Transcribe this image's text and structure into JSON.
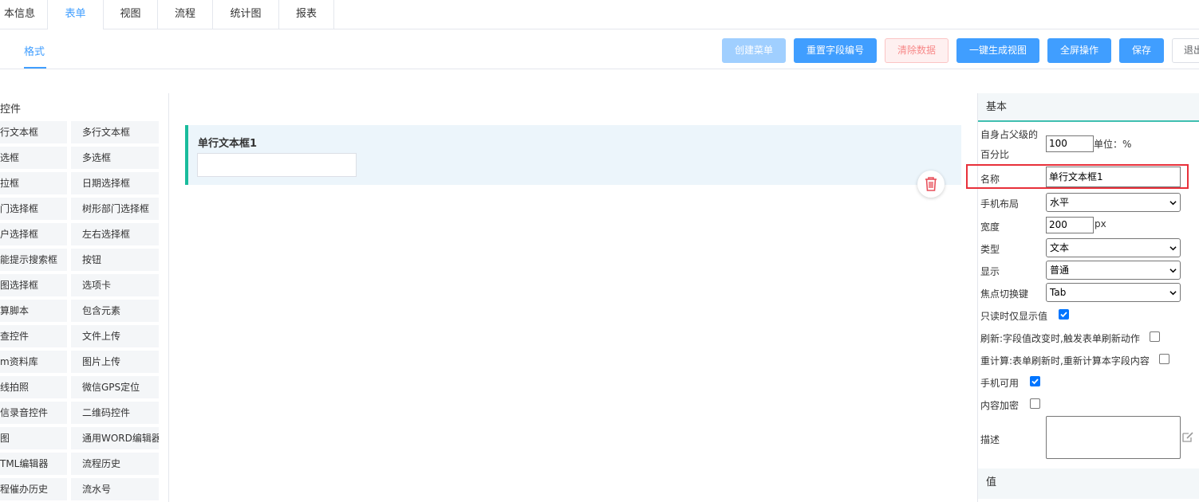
{
  "top_tabs": [
    {
      "label": "本信息"
    },
    {
      "label": "表单"
    },
    {
      "label": "视图"
    },
    {
      "label": "流程"
    },
    {
      "label": "统计图"
    },
    {
      "label": "报表"
    }
  ],
  "sub_tab": {
    "label": "格式"
  },
  "toolbar": {
    "create_menu": "创建菜单",
    "reset_field_no": "重置字段编号",
    "clear_data": "清除数据",
    "gen_view": "一键生成视图",
    "fullscreen": "全屏操作",
    "save": "保存",
    "exit": "退出"
  },
  "palette": {
    "title": "控件",
    "items": [
      [
        "行文本框",
        "多行文本框"
      ],
      [
        "选框",
        "多选框"
      ],
      [
        "拉框",
        "日期选择框"
      ],
      [
        "门选择框",
        "树形部门选择框"
      ],
      [
        "户选择框",
        "左右选择框"
      ],
      [
        "能提示搜索框",
        "按钮"
      ],
      [
        "图选择框",
        "选项卡"
      ],
      [
        "算脚本",
        "包含元素"
      ],
      [
        "查控件",
        "文件上传"
      ],
      [
        "m资料库",
        "图片上传"
      ],
      [
        "线拍照",
        "微信GPS定位"
      ],
      [
        "信录音控件",
        "二维码控件"
      ],
      [
        "图",
        "通用WORD编辑器"
      ],
      [
        "TML编辑器",
        "流程历史"
      ],
      [
        "程催办历史",
        "流水号"
      ]
    ]
  },
  "canvas": {
    "field_label": "单行文本框1"
  },
  "panel": {
    "basic_title": "基本",
    "percent_label_1": "自身占父级的",
    "percent_label_2": "百分比",
    "percent_value": "100",
    "percent_unit": "单位：%",
    "name_label": "名称",
    "name_value": "单行文本框1",
    "mobile_layout_label": "手机布局",
    "mobile_layout_value": "水平",
    "width_label": "宽度",
    "width_value": "200",
    "width_unit": "px",
    "type_label": "类型",
    "type_value": "文本",
    "display_label": "显示",
    "display_value": "普通",
    "focus_label": "焦点切换键",
    "focus_value": "Tab",
    "readonly_label": "只读时仅显示值",
    "readonly_checked": true,
    "refresh_label": "刷新:字段值改变时,触发表单刷新动作",
    "refresh_checked": false,
    "recalc_label": "重计算:表单刷新时,重新计算本字段内容",
    "recalc_checked": false,
    "mobile_label": "手机可用",
    "mobile_checked": true,
    "encrypt_label": "内容加密",
    "encrypt_checked": false,
    "desc_label": "描述",
    "value_title": "值"
  },
  "colors": {
    "accent": "#409eff",
    "field_bar": "#1abc9c",
    "highlight": "#e8303a"
  }
}
